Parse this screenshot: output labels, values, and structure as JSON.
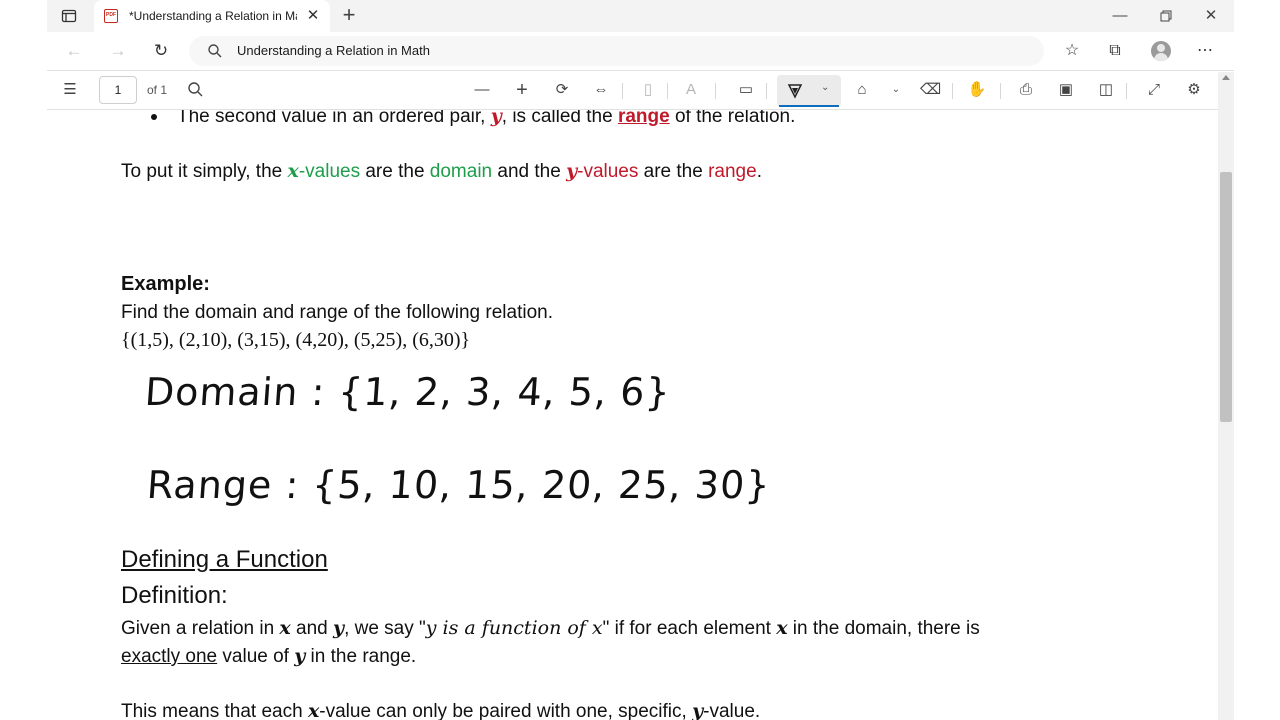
{
  "browser": {
    "tab_title": "*Understanding a Relation in Ma",
    "tab_close": "✕",
    "new_tab": "+",
    "address": "Understanding a Relation in Math",
    "icons": [
      "tab-actions-icon",
      "pdf-file-icon",
      "back-icon",
      "forward-icon",
      "refresh-icon",
      "search-icon",
      "favorites-icon",
      "collections-icon",
      "profile-avatar-icon",
      "more-icon",
      "minimize-icon",
      "restore-icon",
      "close-window-icon"
    ]
  },
  "pdf_toolbar": {
    "page_input": "1",
    "page_of": "of 1",
    "icons": [
      "contents-icon",
      "find-icon",
      "zoom-out-icon",
      "zoom-in-icon",
      "rotate-icon",
      "fit-width-icon",
      "page-view-icon",
      "read-aloud-icon",
      "add-text-icon",
      "draw-icon",
      "highlight-icon",
      "erase-icon",
      "touch-icon",
      "print-icon",
      "save-icon",
      "save-as-icon",
      "fullscreen-icon",
      "settings-icon"
    ]
  },
  "document": {
    "bullet_part1": "The second value in an ordered pair, ",
    "bullet_var": "y",
    "bullet_part2": ", is called the ",
    "bullet_term": "range",
    "bullet_part3": " of the relation.",
    "simple_1": "To put it simply, the ",
    "simple_x": "x",
    "simple_2": "-values",
    "simple_3": " are the ",
    "simple_domain": "domain",
    "simple_4": " and the ",
    "simple_y": "y",
    "simple_5": "-values",
    "simple_6": " are the ",
    "simple_range": "range",
    "simple_7": ".",
    "example_heading": "Example:",
    "example_prompt": "Find the domain and range of the following relation.",
    "example_set": "{(1,5), (2,10), (3,15), (4,20), (5,25), (6,30)}",
    "hand_domain": "Domain : {1, 2, 3, 4, 5, 6}",
    "hand_range": "Range : {5, 10, 15, 20, 25, 30}",
    "function_heading": "Defining a Function",
    "definition_label": "Definition:",
    "def_1": "Given a relation in ",
    "def_x": "x",
    "def_2": " and ",
    "def_y": "y",
    "def_3": ", we say \"",
    "def_quote": "y is a function of x",
    "def_4": "\" if for each element ",
    "def_x2": "x",
    "def_5": " in the domain, there is",
    "def_underlined": "exactly one",
    "def_6": " value of ",
    "def_y2": "y",
    "def_7": " in the range.",
    "means_1": "This means that each ",
    "means_x": "x",
    "means_2": "-value can only be paired with one, specific, ",
    "means_y": "y",
    "means_3": "-value."
  },
  "colors": {
    "green": "#1e9e4a",
    "red": "#c0192a",
    "accent": "#0f6cbd"
  }
}
